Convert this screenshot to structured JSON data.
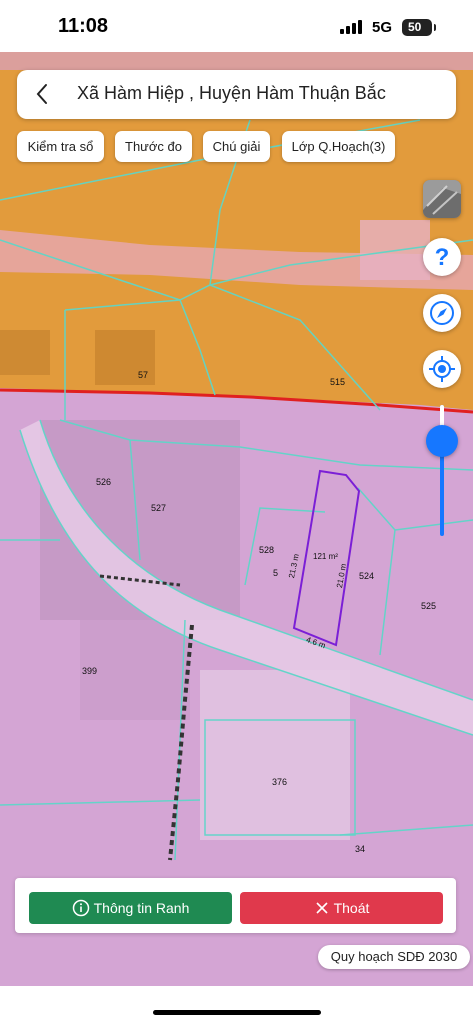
{
  "status_bar": {
    "time": "11:08",
    "network": "5G",
    "battery": "50"
  },
  "header": {
    "title": "Xã Hàm Hiệp , Huyện Hàm Thuận Bắc",
    "back_icon": "chevron-left-icon"
  },
  "chips": [
    {
      "label": "Kiểm tra sổ"
    },
    {
      "label": "Thước đo"
    },
    {
      "label": "Chú giải"
    },
    {
      "label": "Lớp Q.Hoạch(3)"
    }
  ],
  "map_controls": {
    "layer_icon": "map-layer-icon",
    "help_icon": "question-icon",
    "compass_icon": "compass-icon",
    "locate_icon": "my-location-icon",
    "opacity_level": 0.85
  },
  "parcels": {
    "p57": "57",
    "p515": "515",
    "p526": "526",
    "p527": "527",
    "p528": "528",
    "p5": "5",
    "p524": "524",
    "p525": "525",
    "p399": "399",
    "p376": "376",
    "p34": "34"
  },
  "selected_parcel": {
    "area": "121 m²",
    "edge_left": "21.3 m",
    "edge_right": "21.0 m",
    "edge_bottom": "4.6 m"
  },
  "colors": {
    "planning_orange": "#e8a033",
    "residential_pink": "#d9a8d9",
    "boundary_cyan": "#5fd6c8",
    "selected_outline": "#7b1fd6",
    "info_button": "#1f8a52",
    "exit_button": "#e0394c",
    "slider_blue": "#1677ff"
  },
  "actions": {
    "info_label": "Thông tin Ranh",
    "exit_label": "Thoát"
  },
  "plan_badge": "Quy hoạch SDĐ 2030"
}
